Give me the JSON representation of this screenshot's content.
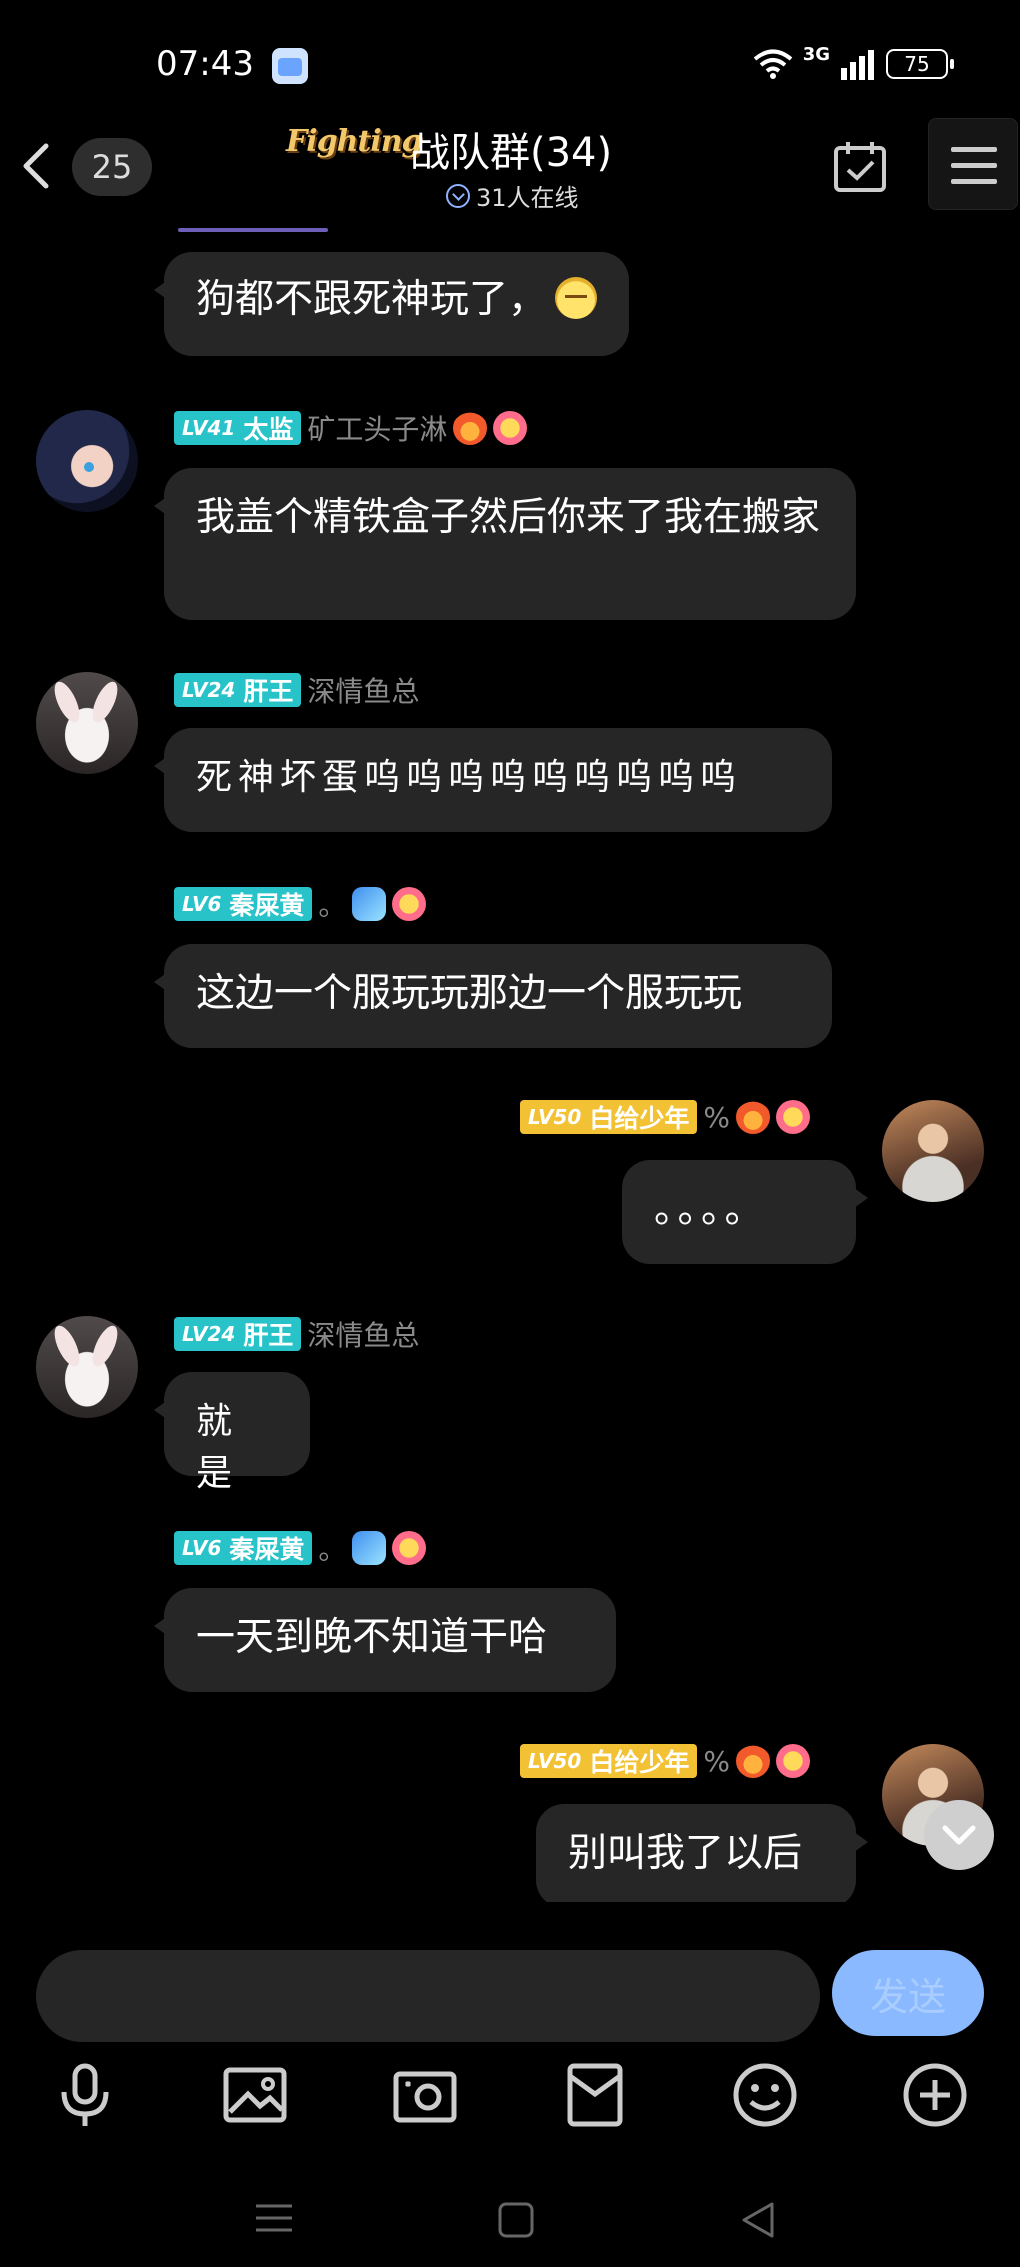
{
  "status_bar": {
    "time": "07:43",
    "network": "3G",
    "battery": "75"
  },
  "header": {
    "unread_count": "25",
    "logo_text": "Fighting",
    "title": "战队群(34)",
    "online": "31人在线"
  },
  "messages": [
    {
      "id": "m0",
      "side": "left",
      "text": "狗都不跟死神玩了，",
      "has_emoji": true
    },
    {
      "id": "m1",
      "side": "left",
      "level": "41",
      "title": "太监",
      "nickname": "矿工头子淋",
      "text": "我盖个精铁盒子然后你来了我在搬家"
    },
    {
      "id": "m2",
      "side": "left",
      "level": "24",
      "title": "肝王",
      "nickname": "深情鱼总",
      "text": "死神坏蛋呜呜呜呜呜呜呜呜呜"
    },
    {
      "id": "m3",
      "side": "left",
      "level": "6",
      "title": "秦屎黄",
      "nickname": "。",
      "text": "这边一个服玩玩那边一个服玩玩"
    },
    {
      "id": "m4",
      "side": "right",
      "level": "50",
      "title": "白给少年",
      "nickname": "%",
      "text": "。。。。"
    },
    {
      "id": "m5",
      "side": "left",
      "level": "24",
      "title": "肝王",
      "nickname": "深情鱼总",
      "text": "就是"
    },
    {
      "id": "m6",
      "side": "left",
      "level": "6",
      "title": "秦屎黄",
      "nickname": "。",
      "text": "一天到晚不知道干哈"
    },
    {
      "id": "m7",
      "side": "right",
      "level": "50",
      "title": "白给少年",
      "nickname": "%",
      "text": "别叫我了以后"
    }
  ],
  "input": {
    "placeholder": "",
    "send_label": "发送"
  },
  "toolbar": [
    "mic-icon",
    "image-icon",
    "camera-icon",
    "red-packet-icon",
    "emoji-icon",
    "plus-icon"
  ],
  "colors": {
    "background": "#000000",
    "bubble": "#262626",
    "badge_cyan": "#27c3c8",
    "badge_gold": "#f3c234",
    "send_button": "#8ab9ff"
  }
}
